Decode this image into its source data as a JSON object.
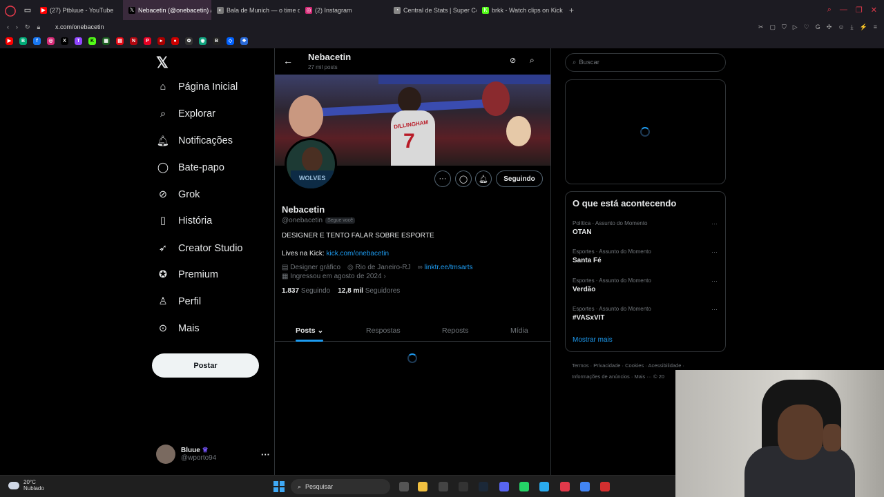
{
  "browser": {
    "tabs": [
      {
        "label": "(27) Ptbluue - YouTube",
        "color": "#ff0000",
        "glyph": "▶"
      },
      {
        "label": "Nebacetin (@onebacetin) /",
        "color": "#000000",
        "glyph": "𝕏",
        "active": true
      },
      {
        "label": "Bala de Munich — o time d",
        "color": "#777777",
        "glyph": "◐"
      },
      {
        "label": "(2) Instagram",
        "color": "#d62976",
        "glyph": "◎"
      },
      {
        "label": "Central de Stats | Super Co",
        "color": "#888888",
        "glyph": "◔"
      },
      {
        "label": "brkk - Watch clips on Kick",
        "color": "#53fc18",
        "glyph": "K"
      }
    ],
    "url": "x.com/onebacetin"
  },
  "nav": {
    "items": [
      {
        "label": "Página Inicial",
        "icon": "home-icon",
        "glyph": "⌂"
      },
      {
        "label": "Explorar",
        "icon": "search-icon",
        "glyph": "⌕"
      },
      {
        "label": "Notificações",
        "icon": "bell-icon",
        "glyph": "🔔︎"
      },
      {
        "label": "Bate-papo",
        "icon": "chat-icon",
        "glyph": "◯"
      },
      {
        "label": "Grok",
        "icon": "grok-icon",
        "glyph": "⊘"
      },
      {
        "label": "História",
        "icon": "bookmark-icon",
        "glyph": "▯"
      },
      {
        "label": "Creator Studio",
        "icon": "rocket-icon",
        "glyph": "➶"
      },
      {
        "label": "Premium",
        "icon": "verified-icon",
        "glyph": "✪"
      },
      {
        "label": "Perfil",
        "icon": "person-icon",
        "glyph": "♙"
      },
      {
        "label": "Mais",
        "icon": "more-circle-icon",
        "glyph": "⊙"
      }
    ],
    "post_label": "Postar"
  },
  "account": {
    "name": "Bluue",
    "handle": "@wporto94"
  },
  "profile": {
    "header_name": "Nebacetin",
    "post_count": "27 mil posts",
    "name": "Nebacetin",
    "handle": "@onebacetin",
    "follows_you": "Segue você",
    "bio": "DESIGNER E TENTO FALAR SOBRE ESPORTE",
    "lives_label": "Lives na Kick: ",
    "lives_link": "kick.com/onebacetin",
    "profession": "Designer gráfico",
    "location": "Rio de Janeiro-RJ",
    "website": "linktr.ee/tmsarts",
    "joined": "Ingressou em agosto de 2024",
    "following_count": "1.837",
    "following_label": "Seguindo",
    "followers_count": "12,8 mil",
    "followers_label": "Seguidores",
    "follow_button": "Seguindo",
    "banner": {
      "jersey_text": "DILLINGHAM",
      "jersey_number": "7"
    },
    "avatar_text": "WOLVES"
  },
  "tabs": [
    "Posts",
    "Respostas",
    "Reposts",
    "Mídia"
  ],
  "right": {
    "search_placeholder": "Buscar",
    "trending_title": "O que está acontecendo",
    "trends": [
      {
        "category": "Política · Assunto do Momento",
        "title": "OTAN"
      },
      {
        "category": "Esportes · Assunto do Momento",
        "title": "Santa Fé"
      },
      {
        "category": "Esportes · Assunto do Momento",
        "title": "Verdão"
      },
      {
        "category": "Esportes · Assunto do Momento",
        "title": "#VASxVIT"
      }
    ],
    "show_more": "Mostrar mais",
    "footer_line1": "Termos · Privacidade · Cookies · Acessibilidade ·",
    "footer_line2": "Informações de anúncios · Mais ··· © 20"
  },
  "taskbar": {
    "temp": "20°C",
    "condition": "Nublado",
    "search": "Pesquisar"
  }
}
